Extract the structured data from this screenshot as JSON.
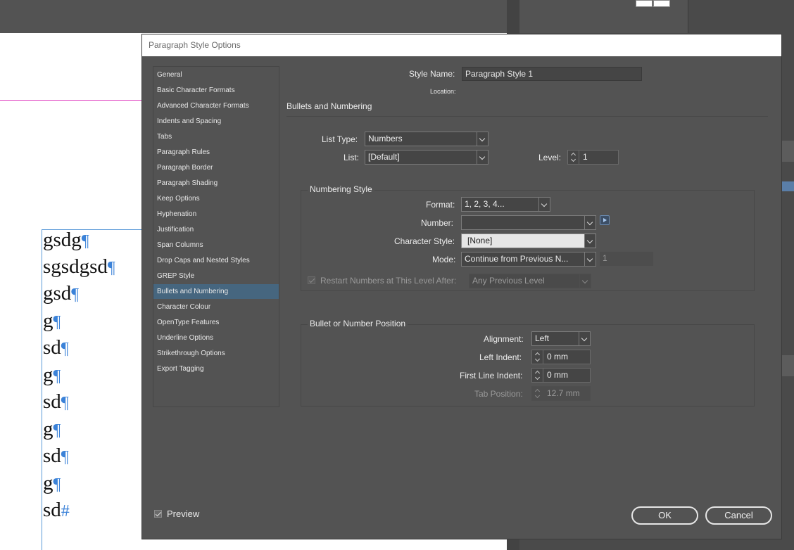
{
  "document": {
    "lines": [
      "gsdg",
      "sgsdgsd",
      "gsd",
      "g",
      "sd",
      "g",
      "sd",
      "g",
      "sd",
      "g",
      "sd"
    ],
    "pilcrow": "¶",
    "end_mark": "#"
  },
  "dialog": {
    "title": "Paragraph Style Options",
    "categories": [
      "General",
      "Basic Character Formats",
      "Advanced Character Formats",
      "Indents and Spacing",
      "Tabs",
      "Paragraph Rules",
      "Paragraph Border",
      "Paragraph Shading",
      "Keep Options",
      "Hyphenation",
      "Justification",
      "Span Columns",
      "Drop Caps and Nested Styles",
      "GREP Style",
      "Bullets and Numbering",
      "Character Colour",
      "OpenType Features",
      "Underline Options",
      "Strikethrough Options",
      "Export Tagging"
    ],
    "selected_category": "Bullets and Numbering",
    "style_name_label": "Style Name:",
    "style_name_value": "Paragraph Style 1",
    "location_label": "Location:",
    "section_title": "Bullets and Numbering",
    "list_type_label": "List Type:",
    "list_type_value": "Numbers",
    "list_label": "List:",
    "list_value": "[Default]",
    "level_label": "Level:",
    "level_value": "1",
    "numbering_style": {
      "title": "Numbering Style",
      "format_label": "Format:",
      "format_value": "1, 2, 3, 4...",
      "number_label": "Number:",
      "number_value": "",
      "char_style_label": "Character Style:",
      "char_style_value": "[None]",
      "mode_label": "Mode:",
      "mode_value": "Continue from Previous N...",
      "mode_start_value": "1",
      "restart_label": "Restart Numbers at This Level After:",
      "restart_value": "Any Previous Level"
    },
    "position": {
      "title": "Bullet or Number Position",
      "alignment_label": "Alignment:",
      "alignment_value": "Left",
      "left_indent_label": "Left Indent:",
      "left_indent_value": "0 mm",
      "first_line_label": "First Line Indent:",
      "first_line_value": "0 mm",
      "tab_position_label": "Tab Position:",
      "tab_position_value": "12.7 mm"
    },
    "preview_label": "Preview",
    "ok_label": "OK",
    "cancel_label": "Cancel"
  }
}
